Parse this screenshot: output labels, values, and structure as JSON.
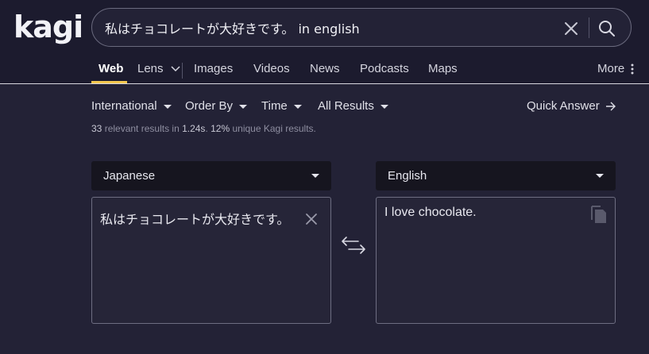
{
  "header": {
    "logo": "kagi",
    "search": {
      "value": "私はチョコレートが大好きです。 in english",
      "clear_icon": "close-icon",
      "submit_icon": "search-icon"
    }
  },
  "tabs": [
    {
      "label": "Web",
      "active": true
    },
    {
      "label": "Lens",
      "icon": "chevron-down-icon"
    },
    {
      "label": "Images"
    },
    {
      "label": "Videos"
    },
    {
      "label": "News"
    },
    {
      "label": "Podcasts"
    },
    {
      "label": "Maps"
    },
    {
      "label": "More",
      "icon": "kebab-icon"
    }
  ],
  "filters": {
    "region": "International",
    "order": "Order By",
    "time": "Time",
    "results": "All Results",
    "quick_answer": "Quick Answer"
  },
  "stats": {
    "count": "33",
    "relevant_text": " relevant results in ",
    "time": "1.24s",
    "sep": ". ",
    "unique_pct": "12%",
    "unique_text": " unique Kagi results."
  },
  "translator": {
    "source_lang": "Japanese",
    "target_lang": "English",
    "source_text": "私はチョコレートが大好きです。",
    "target_text": "I love chocolate."
  },
  "colors": {
    "header_bg": "#1c1b2e",
    "page_bg": "#232236",
    "accent": "#f3c74f",
    "select_bg": "#16151f"
  }
}
